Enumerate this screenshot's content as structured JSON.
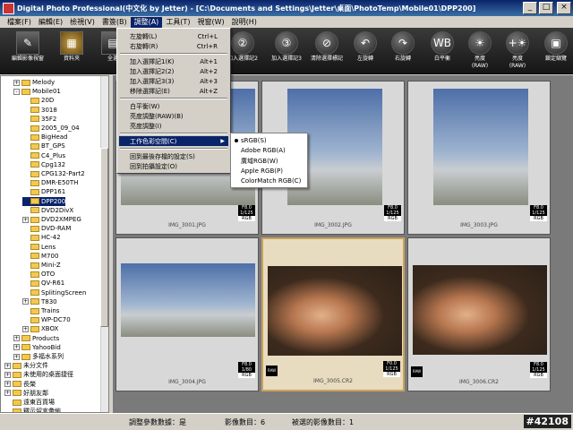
{
  "window": {
    "title": "Digital Photo Professional(中文化 by Jetter) - [C:\\Documents and Settings\\Jetter\\桌面\\PhotoTemp\\Mobile01\\DPP200]",
    "minimize": "_",
    "maximize": "□",
    "close": "×"
  },
  "menubar": [
    {
      "label": "檔案(F)"
    },
    {
      "label": "編輯(E)"
    },
    {
      "label": "檢視(V)"
    },
    {
      "label": "書簽(B)"
    },
    {
      "label": "調整(A)"
    },
    {
      "label": "工具(T)"
    },
    {
      "label": "視窗(W)"
    },
    {
      "label": "說明(H)"
    }
  ],
  "toolbar": [
    {
      "label": "編輯影像視窗",
      "icon": "edit-image-icon"
    },
    {
      "label": "資料夾",
      "icon": "folder-icon"
    },
    {
      "label": "全選",
      "icon": "select-all-icon"
    },
    {
      "label": "加入選擇記2",
      "icon": "check-mark-2-icon"
    },
    {
      "label": "加入選擇記3",
      "icon": "check-mark-3-icon"
    },
    {
      "label": "清除選擇標記",
      "icon": "clear-check-icon"
    },
    {
      "label": "左旋轉",
      "icon": "rotate-left-icon"
    },
    {
      "label": "右旋轉",
      "icon": "rotate-right-icon"
    },
    {
      "label": "白平衡",
      "icon": "white-balance-icon"
    },
    {
      "label": "亮度",
      "sub": "(RAW)",
      "icon": "brightness-raw-icon"
    },
    {
      "label": "亮度",
      "sub": "(RAW)",
      "icon": "brightness-raw-plus-icon"
    },
    {
      "label": "鎖定縮覽",
      "icon": "lock-thumbnail-icon"
    }
  ],
  "tree": [
    {
      "label": "Melody",
      "level": 2,
      "exp": "+"
    },
    {
      "label": "Mobile01",
      "level": 2,
      "exp": "-"
    },
    {
      "label": "20D",
      "level": 3
    },
    {
      "label": "3018",
      "level": 3
    },
    {
      "label": "35F2",
      "level": 3
    },
    {
      "label": "2005_09_04",
      "level": 3
    },
    {
      "label": "BigHead",
      "level": 3
    },
    {
      "label": "BT_GPS",
      "level": 3
    },
    {
      "label": "C4_Plus",
      "level": 3
    },
    {
      "label": "Cpg132",
      "level": 3
    },
    {
      "label": "CPG132-Part2",
      "level": 3
    },
    {
      "label": "DMR-E50TH",
      "level": 3
    },
    {
      "label": "DPP161",
      "level": 3
    },
    {
      "label": "DPP200",
      "level": 3,
      "selected": true
    },
    {
      "label": "DVD2DivX",
      "level": 3
    },
    {
      "label": "DVD2XMPEG",
      "level": 3,
      "exp": "+"
    },
    {
      "label": "DVD-RAM",
      "level": 3
    },
    {
      "label": "HC-42",
      "level": 3
    },
    {
      "label": "Lens",
      "level": 3
    },
    {
      "label": "M700",
      "level": 3
    },
    {
      "label": "Mini-Z",
      "level": 3
    },
    {
      "label": "OTO",
      "level": 3
    },
    {
      "label": "QV-R61",
      "level": 3
    },
    {
      "label": "SplitingScreen",
      "level": 3
    },
    {
      "label": "T830",
      "level": 3,
      "exp": "+"
    },
    {
      "label": "Trains",
      "level": 3
    },
    {
      "label": "WP-DC70",
      "level": 3
    },
    {
      "label": "XBOX",
      "level": 3,
      "exp": "+"
    },
    {
      "label": "Products",
      "level": 2,
      "exp": "+"
    },
    {
      "label": "YahooBid",
      "level": 2,
      "exp": "+"
    },
    {
      "label": "多福水系列",
      "level": 2,
      "exp": "+"
    },
    {
      "label": "未分文件",
      "level": 1,
      "exp": "+"
    },
    {
      "label": "未使用的桌面捷徑",
      "level": 1,
      "exp": "+"
    },
    {
      "label": "長榮",
      "level": 1,
      "exp": "+"
    },
    {
      "label": "好朋友鄰",
      "level": 1,
      "exp": "+"
    },
    {
      "label": "遠東百貨場",
      "level": 1
    },
    {
      "label": "釋示留言彙編",
      "level": 1
    }
  ],
  "thumbnails": [
    {
      "file": "IMG_3001.JPG",
      "aperture": "F8.0",
      "shutter": "1/125",
      "space": "RGB",
      "scene": "sky",
      "raw": false
    },
    {
      "file": "IMG_3002.JPG",
      "aperture": "F8.0",
      "shutter": "1/125",
      "space": "RGB",
      "scene": "sky",
      "raw": false
    },
    {
      "file": "IMG_3003.JPG",
      "aperture": "F8.0",
      "shutter": "1/125",
      "space": "RGB",
      "scene": "sky",
      "raw": false
    },
    {
      "file": "IMG_3004.JPG",
      "aperture": "F8.0",
      "shutter": "1/80",
      "space": "RGB",
      "scene": "sky",
      "raw": false
    },
    {
      "file": "IMG_3005.CR2",
      "aperture": "F0.0",
      "shutter": "1/125",
      "space": "RGB",
      "scene": "kid",
      "raw": true,
      "raw_label": "RAW",
      "selected": true
    },
    {
      "file": "IMG_3006.CR2",
      "aperture": "F8.0",
      "shutter": "1/125",
      "space": "RGB",
      "scene": "kid",
      "raw": true,
      "raw_label": "RAW"
    }
  ],
  "adjust_menu": [
    {
      "label": "左旋轉(L)",
      "shortcut": "Ctrl+L"
    },
    {
      "label": "右旋轉(R)",
      "shortcut": "Ctrl+R"
    },
    {
      "sep": true
    },
    {
      "label": "加入選擇記1(K)",
      "shortcut": "Alt+1"
    },
    {
      "label": "加入選擇記2(2)",
      "shortcut": "Alt+2"
    },
    {
      "label": "加入選擇記3(3)",
      "shortcut": "Alt+3"
    },
    {
      "label": "移除選擇記(E)",
      "shortcut": "Alt+Z"
    },
    {
      "sep": true
    },
    {
      "label": "白平衡(W)",
      "shortcut": ""
    },
    {
      "label": "亮度調整(RAW)(B)",
      "shortcut": ""
    },
    {
      "label": "亮度調整(I)",
      "shortcut": ""
    },
    {
      "sep": true
    },
    {
      "label": "工作色彩空間(C)",
      "shortcut": "",
      "highlighted": true,
      "submenu": true
    },
    {
      "sep": true
    },
    {
      "label": "回到最後存檔的設定(S)",
      "shortcut": ""
    },
    {
      "label": "回到拍攝設定(O)",
      "shortcut": ""
    }
  ],
  "color_space_menu": [
    {
      "label": "sRGB(S)",
      "checked": true
    },
    {
      "label": "Adobe RGB(A)"
    },
    {
      "label": "廣域RGB(W)"
    },
    {
      "label": "Apple RGB(P)"
    },
    {
      "label": "ColorMatch RGB(C)"
    }
  ],
  "status": {
    "adjust": "調整參數數據：是",
    "count": "影像數目：6",
    "selected": "被選的影像數目：1",
    "badge": "#42108"
  }
}
